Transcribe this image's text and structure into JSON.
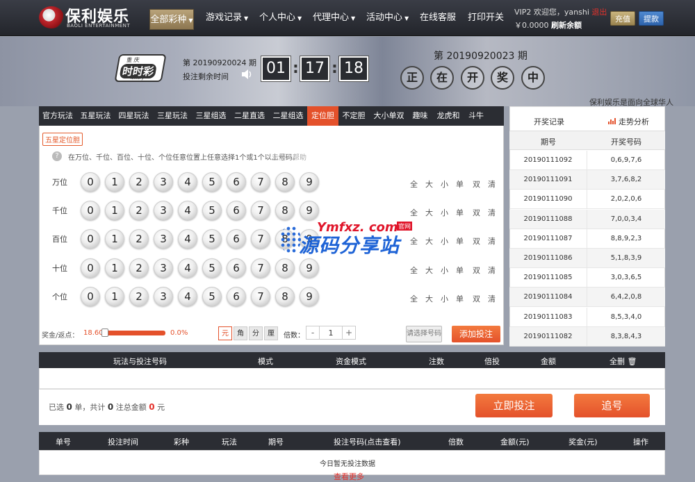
{
  "brand": {
    "name": "保利娱乐",
    "sub": "BAOLI ENTERTAINMENT"
  },
  "nav": {
    "all_lottery": "全部彩种",
    "items": [
      "游戏记录",
      "个人中心",
      "代理中心",
      "活动中心",
      "在线客服",
      "打印开关"
    ]
  },
  "user": {
    "level": "VIP2",
    "welcome": "欢迎您，",
    "name": "yanshi",
    "logout": "退出",
    "balance": "￥0.0000",
    "refresh": "刷新余额",
    "recharge": "充值",
    "withdraw": "提款"
  },
  "lottery": {
    "logo_top": "重 庆",
    "logo_main": "时时彩",
    "logo_sub": "lottery",
    "issue_prefix": "第",
    "issue": "20190920024",
    "issue_suffix": "期",
    "remain_label": "投注剩余时间",
    "timer": [
      "01",
      "17",
      "18"
    ],
    "prev_issue_text": "第 20190920023 期",
    "drawing": [
      "正",
      "在",
      "开",
      "奖",
      "中"
    ],
    "ticker": "保利娱乐是面向全球华人"
  },
  "tabs": [
    "官方玩法",
    "五星玩法",
    "四星玩法",
    "三星玩法",
    "三星组选",
    "二星直选",
    "二星组选",
    "定位胆",
    "不定胆",
    "大小单双",
    "趣味",
    "龙虎和",
    "斗牛"
  ],
  "active_tab": 7,
  "play": {
    "sub_tag": "五星定位胆",
    "help_icon": "?",
    "help": "在万位、千位、百位、十位、个位任意位置上任意选择1个或1个以上号码。",
    "example": "示例",
    "help_link": "帮助",
    "rows": [
      "万位",
      "千位",
      "百位",
      "十位",
      "个位"
    ],
    "digits": [
      "0",
      "1",
      "2",
      "3",
      "4",
      "5",
      "6",
      "7",
      "8",
      "9"
    ],
    "quick": [
      "全",
      "大",
      "小",
      "单",
      "双",
      "清"
    ]
  },
  "prize": {
    "label": "奖金/返点：",
    "value": "18.60",
    "rebate_pct": "0.0%",
    "rebate_fraction": 0.0
  },
  "units": [
    "元",
    "角",
    "分",
    "厘"
  ],
  "active_unit": 0,
  "multiple": {
    "label": "倍数：",
    "minus": "-",
    "value": "1",
    "plus": "+"
  },
  "buttons": {
    "select": "请选择号码",
    "add": "添加投注",
    "bet_now": "立即投注",
    "follow": "追号"
  },
  "watermark": {
    "top": "Ymfxz. com",
    "tag": "官网",
    "main": "源码分享站"
  },
  "history": {
    "tab_record": "开奖记录",
    "tab_trend": "走势分析",
    "col_issue": "期号",
    "col_numbers": "开奖号码",
    "rows": [
      [
        "20190111092",
        "0,6,9,7,6"
      ],
      [
        "20190111091",
        "3,7,6,8,2"
      ],
      [
        "20190111090",
        "2,0,2,0,6"
      ],
      [
        "20190111088",
        "7,0,0,3,4"
      ],
      [
        "20190111087",
        "8,8,9,2,3"
      ],
      [
        "20190111086",
        "5,1,8,3,9"
      ],
      [
        "20190111085",
        "3,0,3,6,5"
      ],
      [
        "20190111084",
        "6,4,2,0,8"
      ],
      [
        "20190111083",
        "8,5,3,4,0"
      ],
      [
        "20190111082",
        "8,3,8,4,3"
      ]
    ]
  },
  "bet_table": {
    "cols": [
      "玩法与投注号码",
      "模式",
      "资金模式",
      "注数",
      "倍投",
      "金额",
      "全删"
    ]
  },
  "summary": {
    "t1": "已选",
    "orders": "0",
    "t2": "单，共计",
    "bets": "0",
    "t3": "注总金额",
    "amount": "0",
    "t4": "元"
  },
  "record_table": {
    "cols": [
      "单号",
      "投注时间",
      "彩种",
      "玩法",
      "期号",
      "投注号码(点击查看)",
      "倍数",
      "金额(元)",
      "奖金(元)",
      "操作"
    ],
    "empty": "今日暂无投注数据",
    "more": "查看更多"
  },
  "colors": {
    "accent": "#e4512b",
    "nav": "#2b2d33",
    "gold": "#b9a37a",
    "blue": "#2e64ad"
  }
}
